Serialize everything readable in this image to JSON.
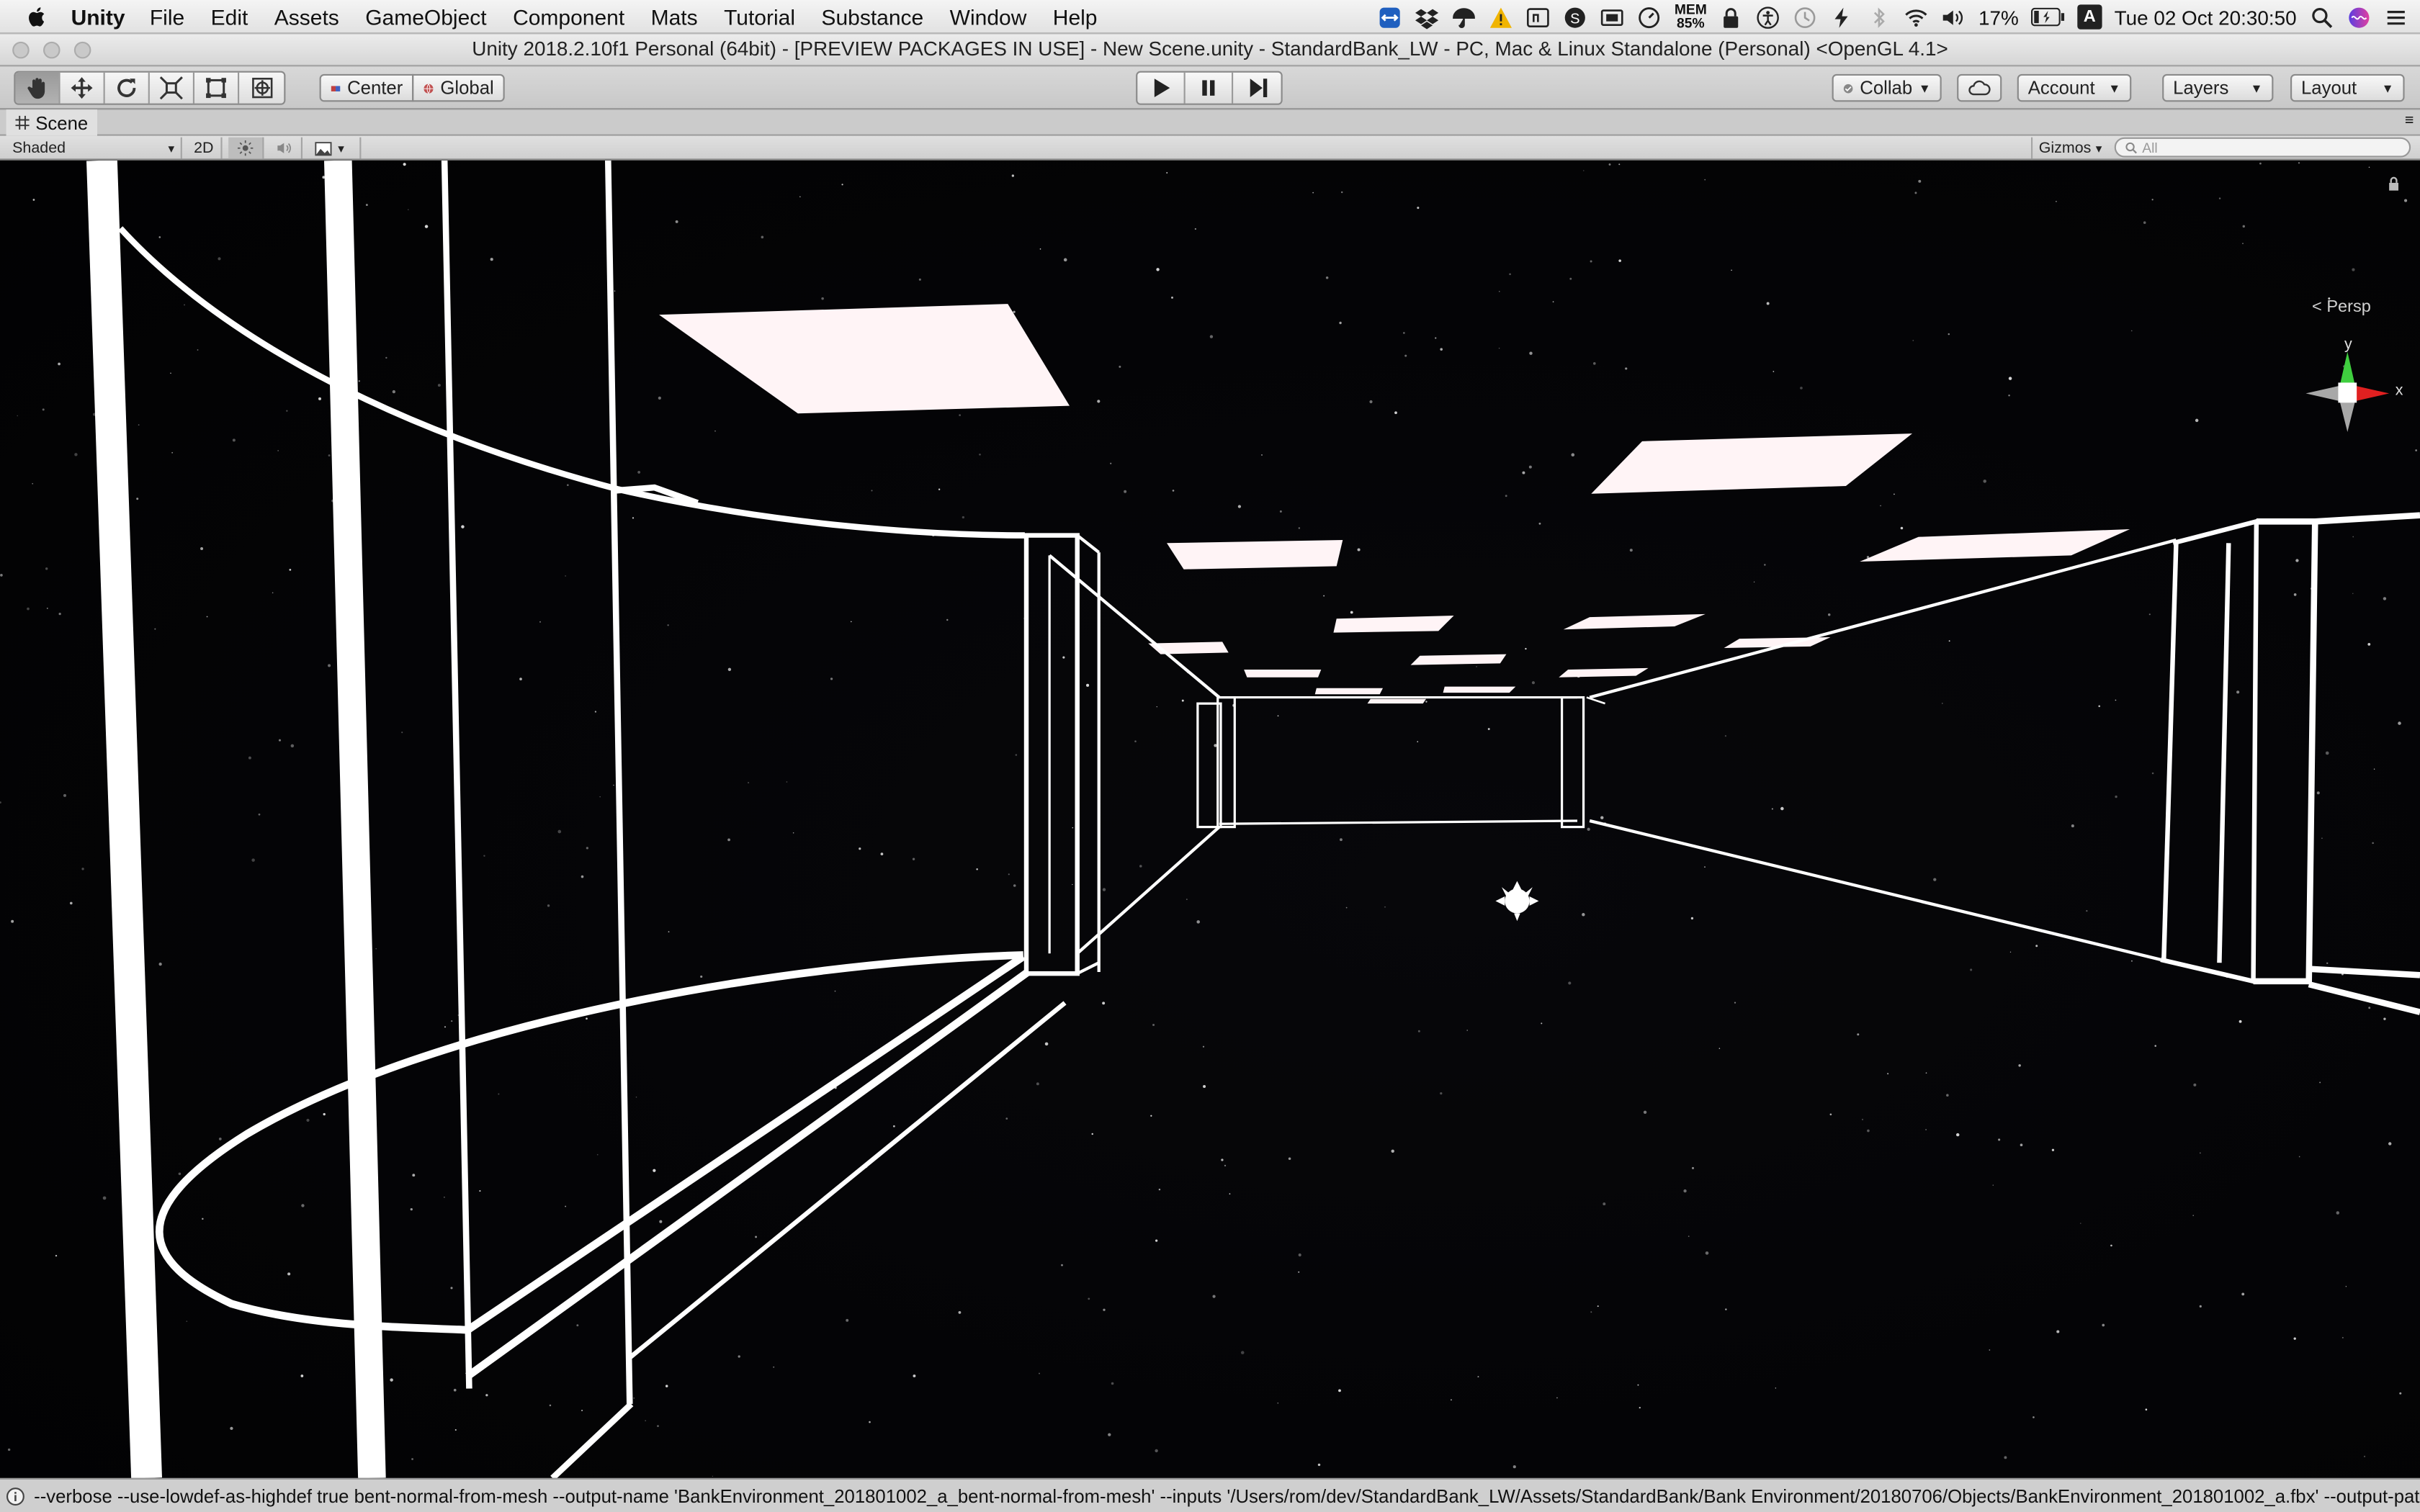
{
  "menubar": {
    "app_name": "Unity",
    "items": [
      "File",
      "Edit",
      "Assets",
      "GameObject",
      "Component",
      "Mats",
      "Tutorial",
      "Substance",
      "Window",
      "Help"
    ],
    "mem_label": "MEM",
    "mem_value": "85%",
    "battery_percent": "17%",
    "input_source": "A",
    "datetime": "Tue 02 Oct  20:30:50"
  },
  "window": {
    "title": "Unity 2018.2.10f1 Personal (64bit) - [PREVIEW PACKAGES IN USE] - New Scene.unity - StandardBank_LW - PC, Mac & Linux Standalone (Personal) <OpenGL 4.1>"
  },
  "toolbar": {
    "pivot_mode": "Center",
    "pivot_rotation": "Global",
    "collab": "Collab",
    "account": "Account",
    "layers": "Layers",
    "layout": "Layout"
  },
  "scene_tab": {
    "label": "Scene"
  },
  "scene_toolbar": {
    "draw_mode": "Shaded",
    "mode_2d": "2D",
    "gizmos": "Gizmos",
    "search_placeholder": "All"
  },
  "viewport": {
    "gizmo_y": "y",
    "gizmo_x": "x",
    "projection": "Persp"
  },
  "status": {
    "message": "--verbose --use-lowdef-as-highdef true bent-normal-from-mesh --output-name 'BankEnvironment_201801002_a_bent-normal-from-mesh' --inputs '/Users/rom/dev/StandardBank_LW/Assets/StandardBank/Bank Environment/20180706/Objects/BankEnvironment_201801002_a.fbx' --output-path '/"
  },
  "colors": {
    "menubar_bg": "#e8e8e8",
    "toolbar_bg": "#cfcfcf",
    "scene_bg": "#020203",
    "wire": "#ffffff",
    "ceiling_light": "#fff4f6",
    "gizmo_x": "#e02020",
    "gizmo_y": "#3fcf3f"
  }
}
